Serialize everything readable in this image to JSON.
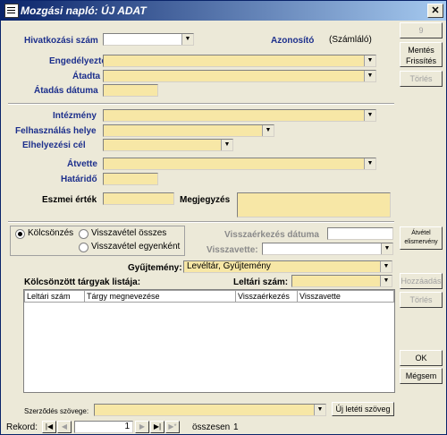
{
  "window": {
    "title": "Mozgási napló: ÚJ ADAT",
    "close": "✕"
  },
  "form": {
    "hivatkozasi_szam": "Hivatkozási szám",
    "azonosito_label": "Azonosító",
    "azonosito_value": "(Számláló)",
    "engedelyezte": "Engedélyezte",
    "atadta": "Átadta",
    "atadas_datuma": "Átadás dátuma",
    "intezmeny": "Intézmény",
    "felhasznalas_helye": "Felhasználás helye",
    "elhelyezesi_cel": "Elhelyezési cél",
    "atvette": "Átvette",
    "hatarido": "Határidő",
    "eszmei_ertek": "Eszmei érték",
    "megjegyzes": "Megjegyzés"
  },
  "side_buttons": {
    "b1": "9",
    "b2": "Mentés Frissítés",
    "b3": "Törlés",
    "b4": "Átvétel elismervény",
    "b5": "Hozzáadás",
    "b6": "Törlés",
    "ok": "OK",
    "cancel": "Mégsem",
    "new_text": "Új letéti szöveg"
  },
  "radios": {
    "kolcsonzes": "Kölcsönzés",
    "visszavetel_osszes": "Visszavétel összes",
    "visszavetel_egyenkent": "Visszavétel egyenként"
  },
  "return": {
    "visszaerkezes_datuma": "Visszaérkezés dátuma",
    "visszavette": "Visszavette:"
  },
  "collection": {
    "label": "Gyűjtemény:",
    "value": "Levéltár, Gyűjtemény"
  },
  "list": {
    "title": "Kölcsönzött tárgyak listája:",
    "leltari_label": "Leltári szám:",
    "columns": [
      "Leltári szám",
      "Tárgy megnevezése",
      "Visszaérkezés",
      "Visszavette"
    ]
  },
  "contract": {
    "label": "Szerződés szövege:"
  },
  "nav": {
    "label": "Rekord:",
    "current": "1",
    "total_label": "összesen",
    "total": "1"
  }
}
